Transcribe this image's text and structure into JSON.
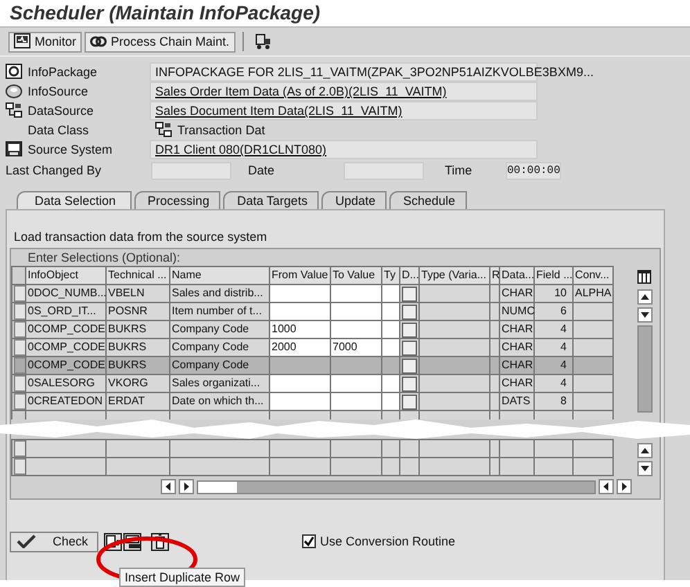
{
  "window": {
    "title": "Scheduler (Maintain InfoPackage)"
  },
  "toolbar": [
    {
      "kind": "monitor",
      "label": "Monitor"
    },
    {
      "kind": "chain",
      "label": "Process Chain Maint."
    },
    {
      "kind": "transport"
    }
  ],
  "header": [
    {
      "kind": "package",
      "label": "InfoPackage",
      "value": "INFOPACKAGE FOR 2LIS_11_VAITM(ZPAK_3PO2NP51AIZKVOLBE3BXM9...",
      "link": false
    },
    {
      "kind": "source",
      "label": "InfoSource",
      "value": "Sales Order Item Data (As of 2.0B)(2LIS_11_VAITM)",
      "link": true
    },
    {
      "kind": "datasource",
      "label": "DataSource",
      "value": "Sales Document Item Data(2LIS_11_VAITM)",
      "link": true
    },
    {
      "kind": "class",
      "label": "Data Class",
      "value": "Transaction Dat",
      "link": false
    },
    {
      "kind": "system",
      "label": "Source System",
      "value": "DR1 Client 080(DR1CLNT080)",
      "link": true
    }
  ],
  "changed": {
    "label": "Last Changed By",
    "date_label": "Date",
    "time_label": "Time",
    "time": "00:00:00"
  },
  "tabs": [
    {
      "label": "Data Selection",
      "selected": true
    },
    {
      "label": "Processing",
      "selected": false
    },
    {
      "label": "Data Targets",
      "selected": false
    },
    {
      "label": "Update",
      "selected": false
    },
    {
      "label": "Schedule",
      "selected": false
    }
  ],
  "intro": "Load transaction data from the source system",
  "table": {
    "title": "Enter Selections (Optional):",
    "columns": [
      "InfoObject",
      "Technical ...",
      "Name",
      "From Value",
      "To Value",
      "Ty",
      "D...",
      "Type (Varia...",
      "R",
      "Data...",
      "Field ...",
      "Conv..."
    ],
    "rows": [
      {
        "infoobject": "0DOC_NUMB...",
        "technical": "VBELN",
        "name": "Sales and distrib...",
        "data": "CHAR",
        "field": "10",
        "conv": "ALPHA",
        "selected": false
      },
      {
        "infoobject": "0S_ORD_IT...",
        "technical": "POSNR",
        "name": "Item number of t...",
        "data": "NUMC",
        "field": "6",
        "selected": false
      },
      {
        "infoobject": "0COMP_CODE",
        "technical": "BUKRS",
        "name": "Company Code",
        "from": "1000",
        "data": "CHAR",
        "field": "4",
        "selected": false
      },
      {
        "infoobject": "0COMP_CODE",
        "technical": "BUKRS",
        "name": "Company Code",
        "from": "2000",
        "to": "7000",
        "data": "CHAR",
        "field": "4",
        "selected": false
      },
      {
        "infoobject": "0COMP_CODE",
        "technical": "BUKRS",
        "name": "Company Code",
        "data": "CHAR",
        "field": "4",
        "selected": true
      },
      {
        "infoobject": "0SALESORG",
        "technical": "VKORG",
        "name": "Sales organizati...",
        "data": "CHAR",
        "field": "4",
        "selected": false
      },
      {
        "infoobject": "0CREATEDON",
        "technical": "ERDAT",
        "name": "Date on which th...",
        "data": "DATS",
        "field": "8",
        "selected": false
      }
    ]
  },
  "check_button": "Check",
  "tooltip": "Insert Duplicate Row",
  "conversion": {
    "label": "Use Conversion Routine",
    "checked": true
  }
}
